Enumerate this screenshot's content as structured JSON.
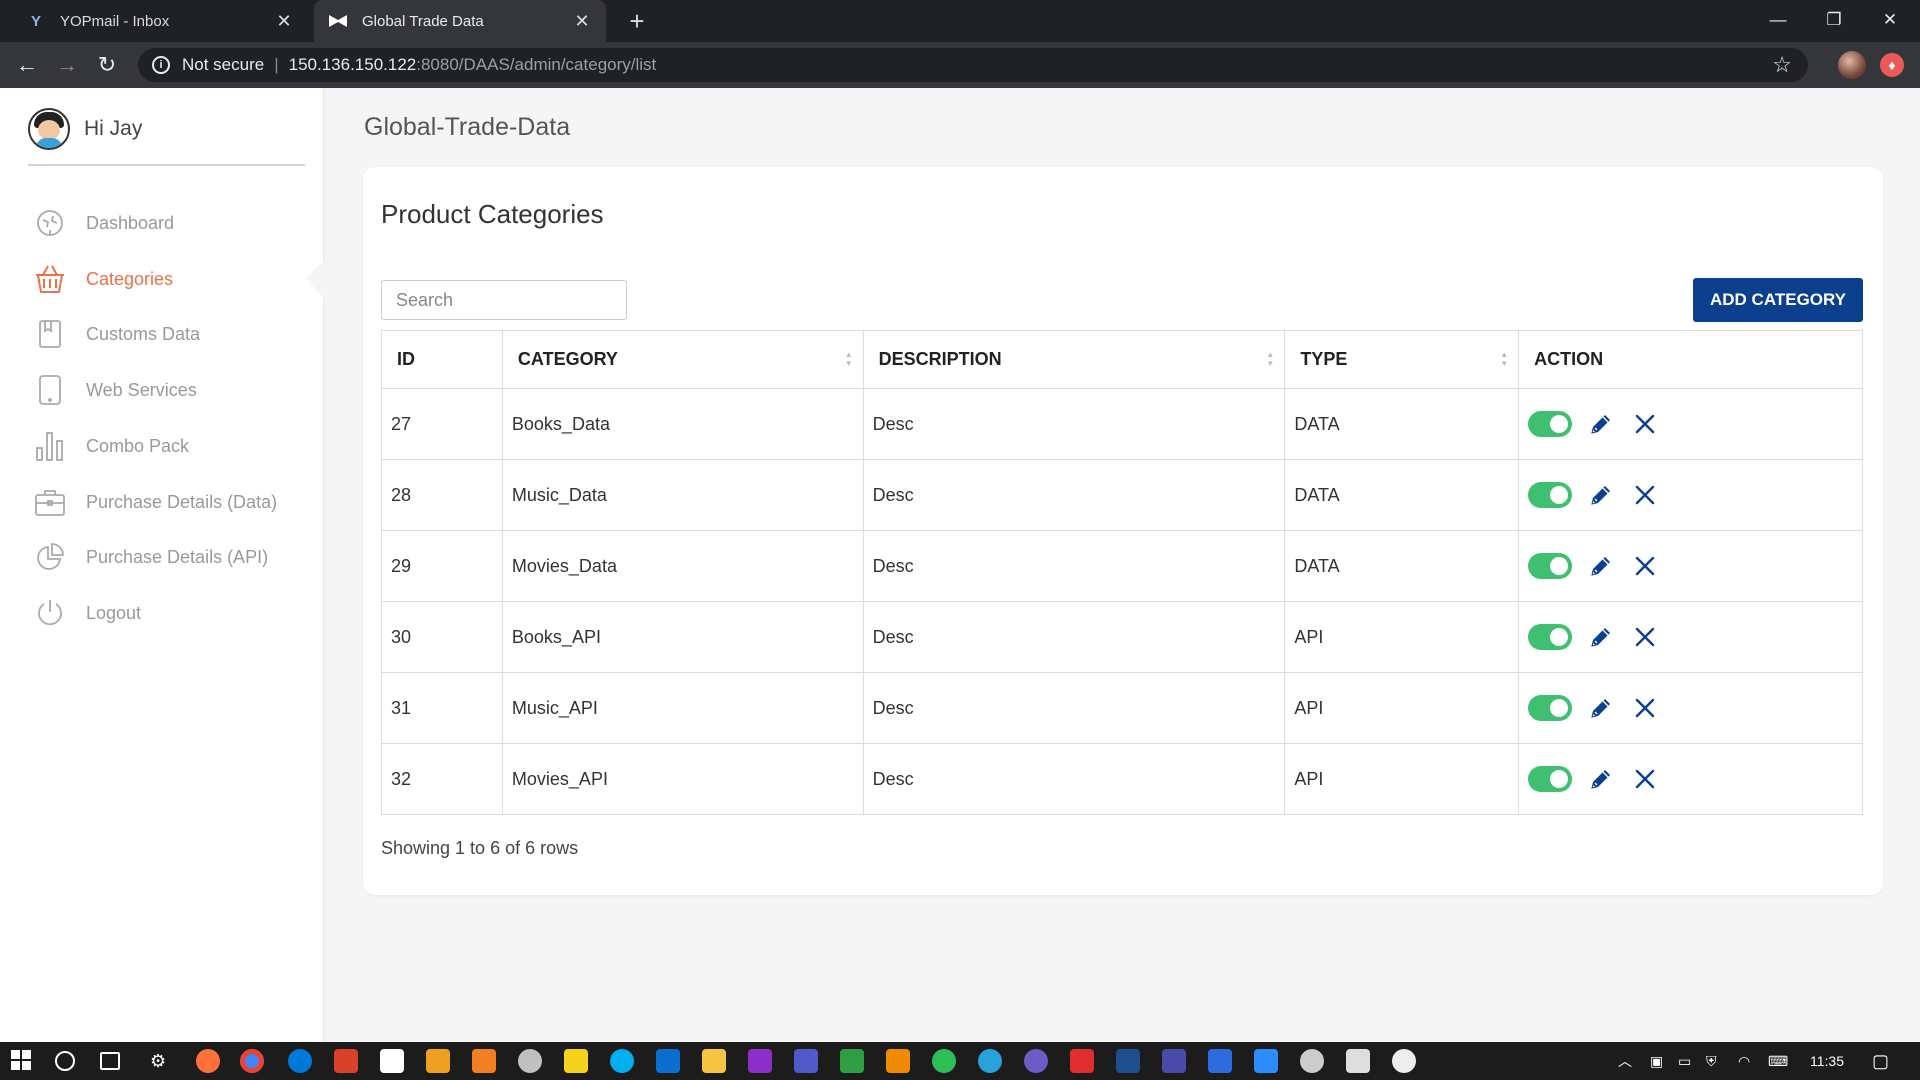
{
  "browser": {
    "tabs": [
      {
        "title": "YOPmail - Inbox",
        "favicon": "Y"
      },
      {
        "title": "Global Trade Data",
        "favicon": "bow"
      }
    ],
    "security": "Not secure",
    "url_host": "150.136.150.122",
    "url_path": ":8080/DAAS/admin/category/list"
  },
  "sidebar": {
    "greeting": "Hi Jay",
    "items": [
      {
        "label": "Dashboard",
        "icon": "dashboard-icon"
      },
      {
        "label": "Categories",
        "icon": "basket-icon",
        "active": true
      },
      {
        "label": "Customs Data",
        "icon": "bookmark-icon"
      },
      {
        "label": "Web Services",
        "icon": "tablet-icon"
      },
      {
        "label": "Combo Pack",
        "icon": "bar-chart-icon"
      },
      {
        "label": "Purchase Details (Data)",
        "icon": "briefcase-icon"
      },
      {
        "label": "Purchase Details (API)",
        "icon": "pie-chart-icon"
      },
      {
        "label": "Logout",
        "icon": "power-icon"
      }
    ]
  },
  "main": {
    "page_title": "Global-Trade-Data",
    "card_title": "Product Categories",
    "search_placeholder": "Search",
    "add_button": "ADD CATEGORY",
    "columns": [
      "ID",
      "CATEGORY",
      "DESCRIPTION",
      "TYPE",
      "ACTION"
    ],
    "rows": [
      {
        "id": "27",
        "category": "Books_Data",
        "description": "Desc",
        "type": "DATA",
        "enabled": true
      },
      {
        "id": "28",
        "category": "Music_Data",
        "description": "Desc",
        "type": "DATA",
        "enabled": true
      },
      {
        "id": "29",
        "category": "Movies_Data",
        "description": "Desc",
        "type": "DATA",
        "enabled": true
      },
      {
        "id": "30",
        "category": "Books_API",
        "description": "Desc",
        "type": "API",
        "enabled": true
      },
      {
        "id": "31",
        "category": "Music_API",
        "description": "Desc",
        "type": "API",
        "enabled": true
      },
      {
        "id": "32",
        "category": "Movies_API",
        "description": "Desc",
        "type": "API",
        "enabled": true
      }
    ],
    "footer": "Showing 1 to 6 of 6 rows"
  },
  "colors": {
    "accent_active": "#e8734a",
    "primary_button": "#0d3f8f",
    "toggle_on": "#3fbf70",
    "icon_blue": "#0d3f8f"
  },
  "taskbar": {
    "time": "11:35"
  }
}
